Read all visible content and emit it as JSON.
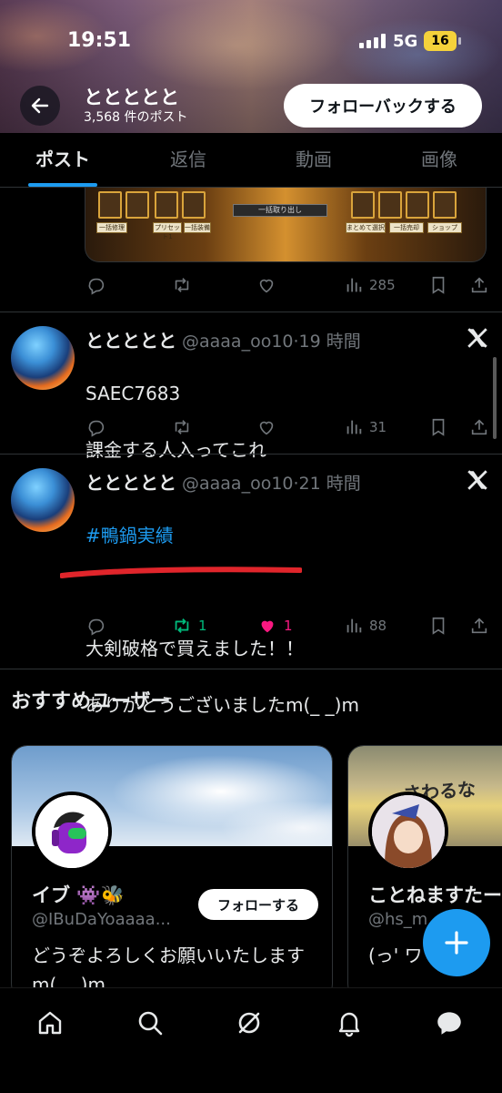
{
  "status_bar": {
    "time": "19:51",
    "network": "5G",
    "battery": "16"
  },
  "profile": {
    "name": "ととととと",
    "post_count": "3,568 件のポスト",
    "follow_back_label": "フォローバックする"
  },
  "tabs": [
    {
      "label": "ポスト",
      "active": true
    },
    {
      "label": "返信",
      "active": false
    },
    {
      "label": "動画",
      "active": false
    },
    {
      "label": "画像",
      "active": false
    }
  ],
  "media_card": {
    "buttons": [
      "一括修理",
      "プリセット1",
      "一括装備",
      "一括取り出し",
      "まとめて選択",
      "一括売却",
      "ショップ"
    ]
  },
  "tweet0": {
    "views": "285"
  },
  "tweet1": {
    "name": "ととととと",
    "meta": "@aaaa_oo10·19 時間",
    "line1": "SAEC7683",
    "line2": "課金する人入ってこれ",
    "views": "31"
  },
  "tweet2": {
    "name": "ととととと",
    "meta": "@aaaa_oo10·21 時間",
    "hashtag": "#鴨鍋実績",
    "line1": "大剣破格で買えました！！",
    "line2": "ありがとうございましたm(_ _)m",
    "retweets": "1",
    "likes": "1",
    "views": "88"
  },
  "recommended": {
    "title": "おすすめユーザー",
    "card1": {
      "name": "イブ 👾🐝",
      "handle": "@IBuDaYoaaaa...",
      "follow_label": "フォローする",
      "bio": "どうぞよろしくお願いいたしますm(_ _)m"
    },
    "card2": {
      "name": "ことねますたー",
      "handle": "@hs_m...lec",
      "banner_text": "さわるな",
      "bio": "(っ' ワ 公開"
    }
  },
  "colors": {
    "accent": "#1d9bf0",
    "like": "#f91880",
    "retweet": "#00ba7c",
    "muted": "#71767b"
  }
}
